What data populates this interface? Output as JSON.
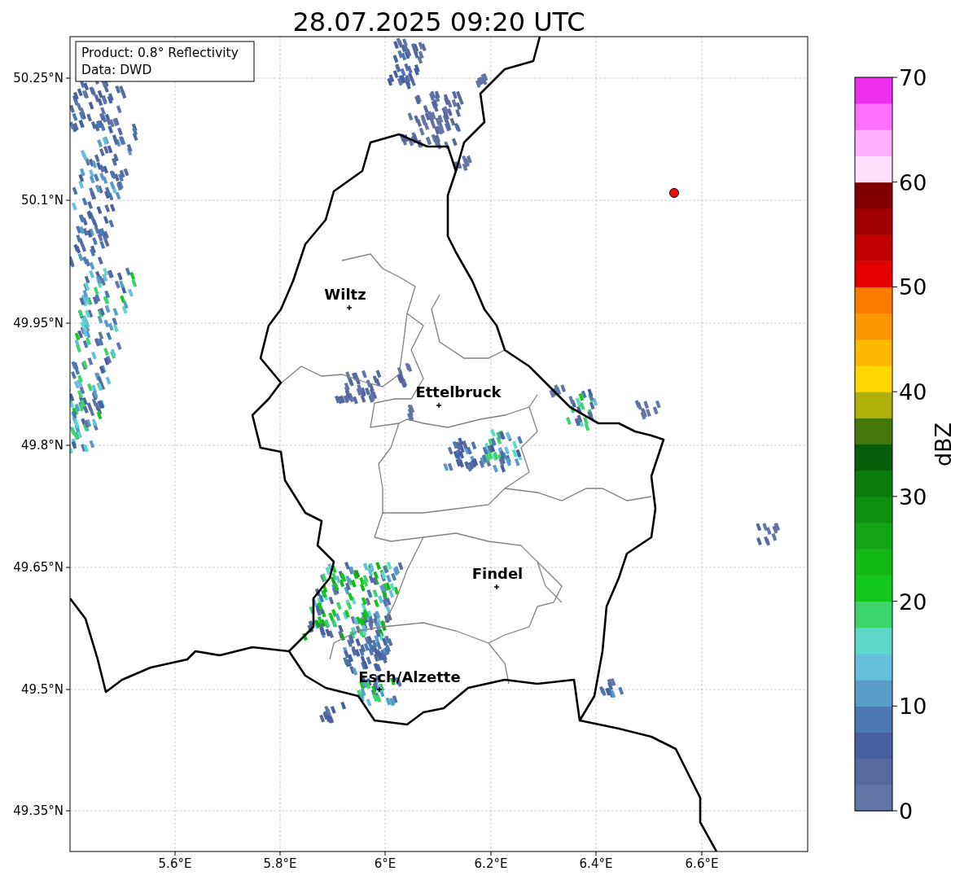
{
  "title": "28.07.2025 09:20 UTC",
  "info_box": [
    "Product: 0.8° Reflectivity",
    "Data: DWD"
  ],
  "places": [
    {
      "name": "Wiltz"
    },
    {
      "name": "Ettelbruck"
    },
    {
      "name": "Findel"
    },
    {
      "name": "Esch/Alzette"
    }
  ],
  "point_marker": {
    "color": "#e81010"
  },
  "x_ticks": [
    "5.6°E",
    "5.8°E",
    "6°E",
    "6.2°E",
    "6.4°E",
    "6.6°E"
  ],
  "y_ticks": [
    "50.25°N",
    "50.1°N",
    "49.95°N",
    "49.8°N",
    "49.65°N",
    "49.5°N",
    "49.35°N"
  ],
  "colorbar": {
    "label": "dBZ",
    "ticks": [
      "70",
      "60",
      "50",
      "40",
      "30",
      "20",
      "10",
      "0"
    ],
    "bins": [
      {
        "color": "#6374a6"
      },
      {
        "color": "#566aa0"
      },
      {
        "color": "#4660a0"
      },
      {
        "color": "#4a78b0"
      },
      {
        "color": "#5a9cc8"
      },
      {
        "color": "#64c0dc"
      },
      {
        "color": "#5ed8c8"
      },
      {
        "color": "#3cd46c"
      },
      {
        "color": "#12c81a"
      },
      {
        "color": "#14b814"
      },
      {
        "color": "#12a412"
      },
      {
        "color": "#0e900e"
      },
      {
        "color": "#0a7c0c"
      },
      {
        "color": "#085e08"
      },
      {
        "color": "#44760a"
      },
      {
        "color": "#b0b00a"
      },
      {
        "color": "#fed600"
      },
      {
        "color": "#fdb800"
      },
      {
        "color": "#fd9800"
      },
      {
        "color": "#fd7c00"
      },
      {
        "color": "#e40000"
      },
      {
        "color": "#c00000"
      },
      {
        "color": "#a00000"
      },
      {
        "color": "#800000"
      },
      {
        "color": "#ffe0ff"
      },
      {
        "color": "#ffb0ff"
      },
      {
        "color": "#ff70ff"
      },
      {
        "color": "#ee30ee"
      }
    ]
  }
}
